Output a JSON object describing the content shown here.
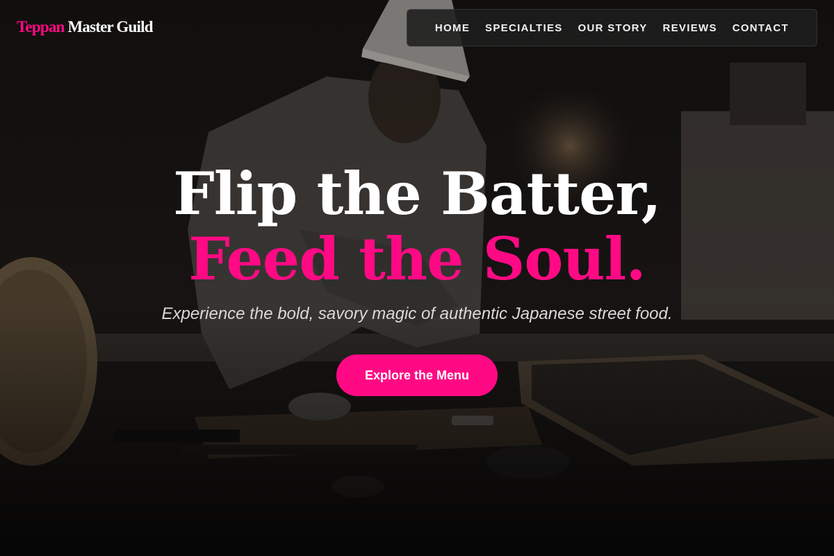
{
  "brand": {
    "accent": "Teppan",
    "rest": " Master Guild"
  },
  "nav": {
    "items": [
      {
        "label": "HOME"
      },
      {
        "label": "SPECIALTIES"
      },
      {
        "label": "OUR STORY"
      },
      {
        "label": "REVIEWS"
      },
      {
        "label": "CONTACT"
      }
    ]
  },
  "hero": {
    "title_line1": "Flip the Batter,",
    "title_line2": "Feed the Soul.",
    "subtitle": "Experience the bold, savory magic of authentic Japanese street food.",
    "cta_label": "Explore the Menu"
  },
  "colors": {
    "accent": "#ff0a84",
    "nav_background": "#1e1e1e",
    "text": "#ffffff"
  }
}
